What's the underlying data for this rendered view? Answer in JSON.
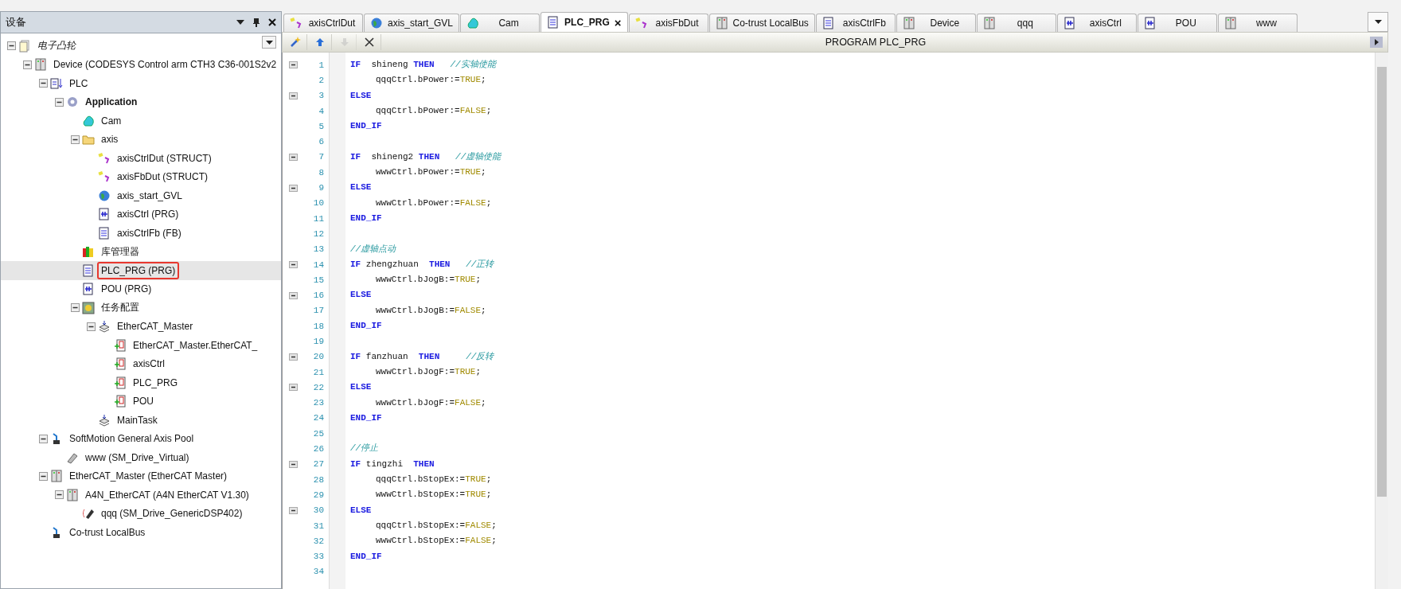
{
  "devices_panel": {
    "title": "设备",
    "tree": [
      {
        "label": "电子凸轮",
        "kind": "project",
        "italic": true,
        "expanded": true,
        "selected": false,
        "children": [
          {
            "label": "Device (CODESYS Control arm CTH3 C36-001S2v2",
            "kind": "device",
            "expanded": true,
            "selected": false,
            "children": [
              {
                "label": "PLC",
                "kind": "plc",
                "expanded": true,
                "selected": false,
                "children": [
                  {
                    "label": "Application",
                    "kind": "app",
                    "bold": true,
                    "expanded": true,
                    "selected": false,
                    "children": [
                      {
                        "label": "Cam",
                        "kind": "cam",
                        "selected": false
                      },
                      {
                        "label": "axis",
                        "kind": "folder",
                        "expanded": true,
                        "selected": false,
                        "children": [
                          {
                            "label": "axisCtrlDut (STRUCT)",
                            "kind": "dut",
                            "selected": false
                          },
                          {
                            "label": "axisFbDut (STRUCT)",
                            "kind": "dut",
                            "selected": false
                          },
                          {
                            "label": "axis_start_GVL",
                            "kind": "gvl",
                            "selected": false
                          },
                          {
                            "label": "axisCtrl (PRG)",
                            "kind": "prg",
                            "selected": false
                          },
                          {
                            "label": "axisCtrlFb (FB)",
                            "kind": "fb",
                            "selected": false
                          }
                        ]
                      },
                      {
                        "label": "库管理器",
                        "kind": "lib",
                        "selected": false
                      },
                      {
                        "label": "PLC_PRG (PRG)",
                        "kind": "fb",
                        "selected": true
                      },
                      {
                        "label": "POU (PRG)",
                        "kind": "prg",
                        "selected": false
                      },
                      {
                        "label": "任务配置",
                        "kind": "taskcfg",
                        "expanded": true,
                        "selected": false,
                        "children": [
                          {
                            "label": "EtherCAT_Master",
                            "kind": "task",
                            "expanded": true,
                            "selected": false,
                            "children": [
                              {
                                "label": "EtherCAT_Master.EtherCAT_",
                                "kind": "call",
                                "selected": false
                              },
                              {
                                "label": "axisCtrl",
                                "kind": "call",
                                "selected": false
                              },
                              {
                                "label": "PLC_PRG",
                                "kind": "call",
                                "selected": false
                              },
                              {
                                "label": "POU",
                                "kind": "call",
                                "selected": false
                              }
                            ]
                          },
                          {
                            "label": "MainTask",
                            "kind": "task",
                            "selected": false
                          }
                        ]
                      }
                    ]
                  }
                ]
              },
              {
                "label": "SoftMotion General Axis Pool",
                "kind": "pool",
                "expanded": true,
                "selected": false,
                "children": [
                  {
                    "label": "www (SM_Drive_Virtual)",
                    "kind": "drive",
                    "selected": false
                  }
                ]
              },
              {
                "label": "EtherCAT_Master (EtherCAT Master)",
                "kind": "device",
                "expanded": true,
                "selected": false,
                "children": [
                  {
                    "label": "A4N_EtherCAT (A4N EtherCAT V1.30)",
                    "kind": "device",
                    "expanded": true,
                    "selected": false,
                    "children": [
                      {
                        "label": "qqq (SM_Drive_GenericDSP402)",
                        "kind": "drive2",
                        "selected": false
                      }
                    ]
                  }
                ]
              },
              {
                "label": "Co-trust LocalBus",
                "kind": "pool",
                "selected": false
              }
            ]
          }
        ]
      }
    ]
  },
  "tabs": [
    {
      "label": "axisCtrlDut",
      "kind": "dut",
      "selected": false
    },
    {
      "label": "axis_start_GVL",
      "kind": "gvl",
      "selected": false
    },
    {
      "label": "Cam",
      "kind": "cam",
      "selected": false
    },
    {
      "label": "PLC_PRG",
      "kind": "fb",
      "selected": true,
      "close": "×"
    },
    {
      "label": "axisFbDut",
      "kind": "dut",
      "selected": false
    },
    {
      "label": "Co-trust LocalBus",
      "kind": "device",
      "selected": false
    },
    {
      "label": "axisCtrlFb",
      "kind": "fb",
      "selected": false
    },
    {
      "label": "Device",
      "kind": "device",
      "selected": false
    },
    {
      "label": "qqq",
      "kind": "device",
      "selected": false
    },
    {
      "label": "axisCtrl",
      "kind": "prg",
      "selected": false
    },
    {
      "label": "POU",
      "kind": "prg",
      "selected": false
    },
    {
      "label": "www",
      "kind": "device",
      "selected": false
    }
  ],
  "editor": {
    "title": "PROGRAM PLC_PRG",
    "toolbar": [
      {
        "kind": "wand",
        "disabled": false
      },
      {
        "kind": "up",
        "disabled": false
      },
      {
        "kind": "down",
        "disabled": true
      },
      {
        "kind": "delete",
        "disabled": false
      }
    ],
    "lines": [
      {
        "n": "1",
        "fold": true,
        "indented": false,
        "tokens": [
          {
            "kind": "kw",
            "text": "IF"
          },
          {
            "kind": "id",
            "text": "  shineng "
          },
          {
            "kind": "kw",
            "text": "THEN"
          },
          {
            "kind": "cm",
            "text": "   //实轴使能"
          }
        ]
      },
      {
        "n": "2",
        "fold": false,
        "indented": true,
        "tokens": [
          {
            "kind": "id",
            "text": "qqqCtrl.bPower:="
          },
          {
            "kind": "lit",
            "text": "TRUE"
          },
          {
            "kind": "id",
            "text": ";"
          }
        ]
      },
      {
        "n": "3",
        "fold": true,
        "indented": false,
        "tokens": [
          {
            "kind": "kw",
            "text": "ELSE"
          }
        ]
      },
      {
        "n": "4",
        "fold": false,
        "indented": true,
        "tokens": [
          {
            "kind": "id",
            "text": "qqqCtrl.bPower:="
          },
          {
            "kind": "lit",
            "text": "FALSE"
          },
          {
            "kind": "id",
            "text": ";"
          }
        ]
      },
      {
        "n": "5",
        "fold": false,
        "indented": false,
        "tokens": [
          {
            "kind": "kw",
            "text": "END_IF"
          }
        ]
      },
      {
        "n": "6",
        "fold": false
      },
      {
        "n": "7",
        "fold": true,
        "indented": false,
        "tokens": [
          {
            "kind": "kw",
            "text": "IF"
          },
          {
            "kind": "id",
            "text": "  shineng2 "
          },
          {
            "kind": "kw",
            "text": "THEN"
          },
          {
            "kind": "cm",
            "text": "   //虚轴使能"
          }
        ]
      },
      {
        "n": "8",
        "fold": false,
        "indented": true,
        "tokens": [
          {
            "kind": "id",
            "text": "wwwCtrl.bPower:="
          },
          {
            "kind": "lit",
            "text": "TRUE"
          },
          {
            "kind": "id",
            "text": ";"
          }
        ]
      },
      {
        "n": "9",
        "fold": true,
        "indented": false,
        "tokens": [
          {
            "kind": "kw",
            "text": "ELSE"
          }
        ]
      },
      {
        "n": "10",
        "fold": false,
        "indented": true,
        "tokens": [
          {
            "kind": "id",
            "text": "wwwCtrl.bPower:="
          },
          {
            "kind": "lit",
            "text": "FALSE"
          },
          {
            "kind": "id",
            "text": ";"
          }
        ]
      },
      {
        "n": "11",
        "fold": false,
        "indented": false,
        "tokens": [
          {
            "kind": "kw",
            "text": "END_IF"
          }
        ]
      },
      {
        "n": "12",
        "fold": false
      },
      {
        "n": "13",
        "fold": false,
        "indented": false,
        "tokens": [
          {
            "kind": "cm",
            "text": "//虚轴点动"
          }
        ]
      },
      {
        "n": "14",
        "fold": true,
        "indented": false,
        "tokens": [
          {
            "kind": "kw",
            "text": "IF"
          },
          {
            "kind": "id",
            "text": " zhengzhuan  "
          },
          {
            "kind": "kw",
            "text": "THEN"
          },
          {
            "kind": "cm",
            "text": "   //正转"
          }
        ]
      },
      {
        "n": "15",
        "fold": false,
        "indented": true,
        "tokens": [
          {
            "kind": "id",
            "text": "wwwCtrl.bJogB:="
          },
          {
            "kind": "lit",
            "text": "TRUE"
          },
          {
            "kind": "id",
            "text": ";"
          }
        ]
      },
      {
        "n": "16",
        "fold": true,
        "indented": false,
        "tokens": [
          {
            "kind": "kw",
            "text": "ELSE"
          }
        ]
      },
      {
        "n": "17",
        "fold": false,
        "indented": true,
        "tokens": [
          {
            "kind": "id",
            "text": "wwwCtrl.bJogB:="
          },
          {
            "kind": "lit",
            "text": "FALSE"
          },
          {
            "kind": "id",
            "text": ";"
          }
        ]
      },
      {
        "n": "18",
        "fold": false,
        "indented": false,
        "tokens": [
          {
            "kind": "kw",
            "text": "END_IF"
          }
        ]
      },
      {
        "n": "19",
        "fold": false
      },
      {
        "n": "20",
        "fold": true,
        "indented": false,
        "tokens": [
          {
            "kind": "kw",
            "text": "IF"
          },
          {
            "kind": "id",
            "text": " fanzhuan  "
          },
          {
            "kind": "kw",
            "text": "THEN"
          },
          {
            "kind": "cm",
            "text": "     //反转"
          }
        ]
      },
      {
        "n": "21",
        "fold": false,
        "indented": true,
        "tokens": [
          {
            "kind": "id",
            "text": "wwwCtrl.bJogF:="
          },
          {
            "kind": "lit",
            "text": "TRUE"
          },
          {
            "kind": "id",
            "text": ";"
          }
        ]
      },
      {
        "n": "22",
        "fold": true,
        "indented": false,
        "tokens": [
          {
            "kind": "kw",
            "text": "ELSE"
          }
        ]
      },
      {
        "n": "23",
        "fold": false,
        "indented": true,
        "tokens": [
          {
            "kind": "id",
            "text": "wwwCtrl.bJogF:="
          },
          {
            "kind": "lit",
            "text": "FALSE"
          },
          {
            "kind": "id",
            "text": ";"
          }
        ]
      },
      {
        "n": "24",
        "fold": false,
        "indented": false,
        "tokens": [
          {
            "kind": "kw",
            "text": "END_IF"
          }
        ]
      },
      {
        "n": "25",
        "fold": false
      },
      {
        "n": "26",
        "fold": false,
        "indented": false,
        "tokens": [
          {
            "kind": "cm",
            "text": "//停止"
          }
        ]
      },
      {
        "n": "27",
        "fold": true,
        "indented": false,
        "tokens": [
          {
            "kind": "kw",
            "text": "IF"
          },
          {
            "kind": "id",
            "text": " tingzhi  "
          },
          {
            "kind": "kw",
            "text": "THEN"
          }
        ]
      },
      {
        "n": "28",
        "fold": false,
        "indented": true,
        "tokens": [
          {
            "kind": "id",
            "text": "qqqCtrl.bStopEx:="
          },
          {
            "kind": "lit",
            "text": "TRUE"
          },
          {
            "kind": "id",
            "text": ";"
          }
        ]
      },
      {
        "n": "29",
        "fold": false,
        "indented": true,
        "tokens": [
          {
            "kind": "id",
            "text": "wwwCtrl.bStopEx:="
          },
          {
            "kind": "lit",
            "text": "TRUE"
          },
          {
            "kind": "id",
            "text": ";"
          }
        ]
      },
      {
        "n": "30",
        "fold": true,
        "indented": false,
        "tokens": [
          {
            "kind": "kw",
            "text": "ELSE"
          }
        ]
      },
      {
        "n": "31",
        "fold": false,
        "indented": true,
        "tokens": [
          {
            "kind": "id",
            "text": "qqqCtrl.bStopEx:="
          },
          {
            "kind": "lit",
            "text": "FALSE"
          },
          {
            "kind": "id",
            "text": ";"
          }
        ]
      },
      {
        "n": "32",
        "fold": false,
        "indented": true,
        "tokens": [
          {
            "kind": "id",
            "text": "wwwCtrl.bStopEx:="
          },
          {
            "kind": "lit",
            "text": "FALSE"
          },
          {
            "kind": "id",
            "text": ";"
          }
        ]
      },
      {
        "n": "33",
        "fold": false,
        "indented": false,
        "tokens": [
          {
            "kind": "kw",
            "text": "END_IF"
          }
        ]
      },
      {
        "n": "34",
        "fold": false
      }
    ]
  }
}
